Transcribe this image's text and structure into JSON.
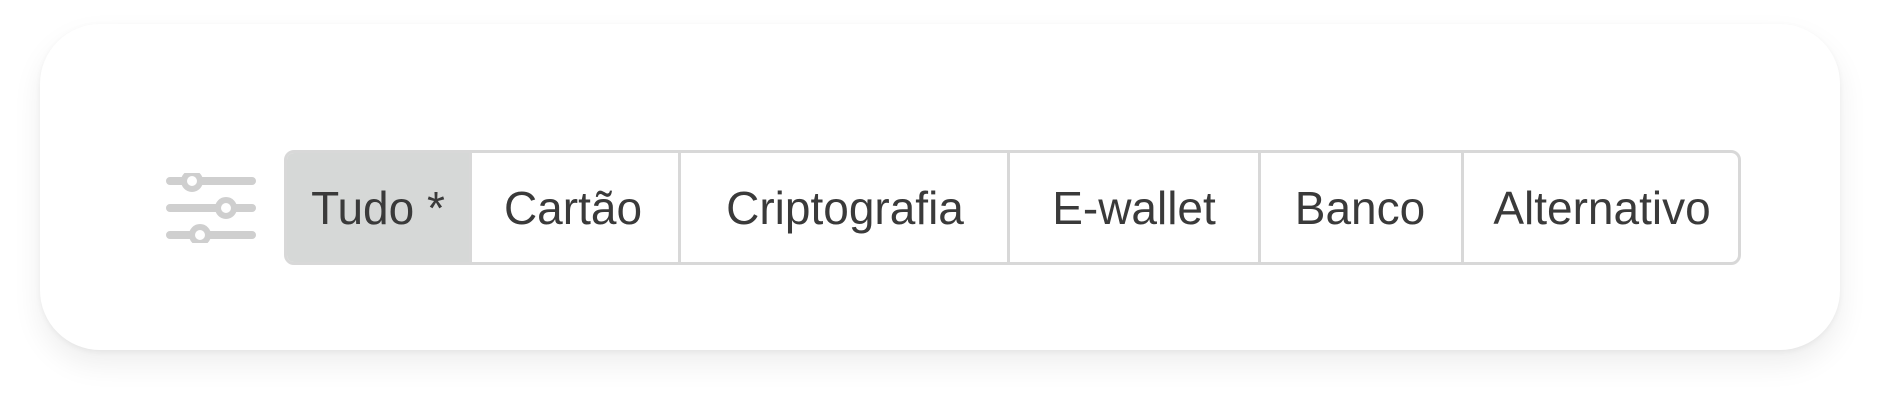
{
  "filter": {
    "icon": "sliders-icon",
    "tabs": [
      {
        "label": "Tudo *",
        "active": true
      },
      {
        "label": "Cartão",
        "active": false
      },
      {
        "label": "Criptografia",
        "active": false
      },
      {
        "label": "E-wallet",
        "active": false
      },
      {
        "label": "Banco",
        "active": false
      },
      {
        "label": "Alternativo",
        "active": false
      }
    ]
  },
  "colors": {
    "active_bg": "#d6d8d7",
    "border": "#d8d8d8",
    "text": "#3a3a3a",
    "icon": "#cfcfcf"
  }
}
